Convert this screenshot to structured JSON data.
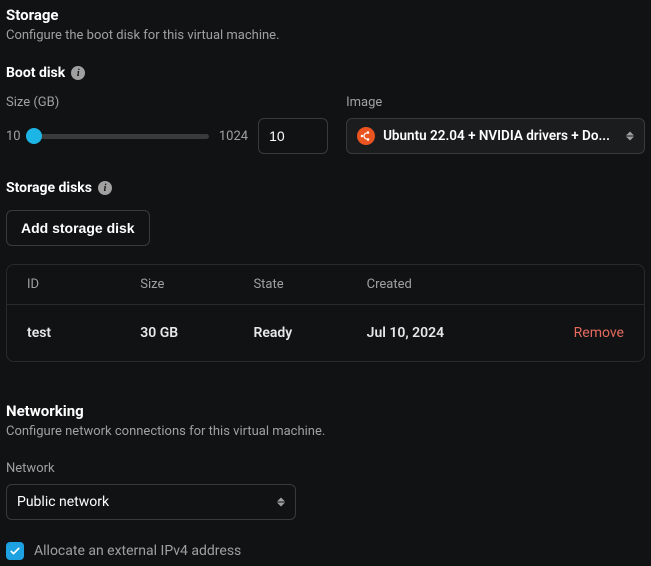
{
  "storage": {
    "title": "Storage",
    "desc": "Configure the boot disk for this virtual machine.",
    "boot_disk_title": "Boot disk",
    "size_label": "Size (GB)",
    "size_min": "10",
    "size_max": "1024",
    "size_value": "10",
    "image_label": "Image",
    "image_value": "Ubuntu 22.04 + NVIDIA drivers + Do...",
    "storage_disks_title": "Storage disks",
    "add_btn": "Add storage disk",
    "table": {
      "headers": {
        "id": "ID",
        "size": "Size",
        "state": "State",
        "created": "Created"
      },
      "row": {
        "id": "test",
        "size": "30 GB",
        "state": "Ready",
        "created": "Jul 10, 2024",
        "remove": "Remove"
      }
    }
  },
  "networking": {
    "title": "Networking",
    "desc": "Configure network connections for this virtual machine.",
    "network_label": "Network",
    "network_value": "Public network",
    "allocate_label": "Allocate an external IPv4 address"
  }
}
